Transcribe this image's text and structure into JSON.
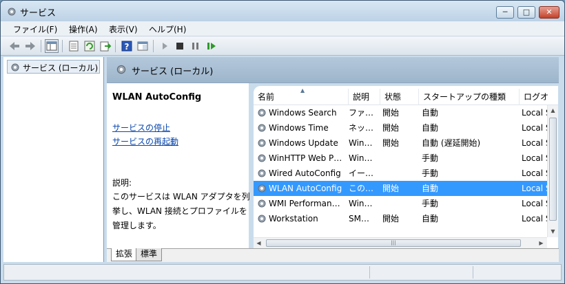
{
  "window": {
    "title": "サービス",
    "min_label": "─",
    "max_label": "□",
    "close_label": "✕"
  },
  "menu": [
    "ファイル(F)",
    "操作(A)",
    "表示(V)",
    "ヘルプ(H)"
  ],
  "toolbar": {
    "icons": [
      "back-icon",
      "forward-icon",
      "console-tree-icon",
      "properties-icon",
      "refresh-icon",
      "export-icon",
      "help-icon",
      "view-icon",
      "start-icon",
      "stop-icon",
      "pause-icon",
      "resume-icon"
    ]
  },
  "tree": {
    "item": "サービス (ローカル)"
  },
  "pane": {
    "title": "サービス (ローカル)",
    "selected_name": "WLAN AutoConfig",
    "link_stop": "サービスの停止",
    "link_restart": "サービスの再起動",
    "desc_label": "説明:",
    "desc_text": "このサービスは WLAN アダプタを列挙し、WLAN 接続とプロファイルを管理します。"
  },
  "columns": [
    "名前",
    "説明",
    "状態",
    "スタートアップの種類",
    "ログオ"
  ],
  "rows": [
    {
      "name": "Windows Search",
      "desc": "ファ…",
      "status": "開始",
      "startup": "自動",
      "logon": "Local S"
    },
    {
      "name": "Windows Time",
      "desc": "ネッ…",
      "status": "開始",
      "startup": "自動",
      "logon": "Local S"
    },
    {
      "name": "Windows Update",
      "desc": "Win…",
      "status": "開始",
      "startup": "自動 (遅延開始)",
      "logon": "Local S"
    },
    {
      "name": "WinHTTP Web P…",
      "desc": "Win…",
      "status": "",
      "startup": "手動",
      "logon": "Local S"
    },
    {
      "name": "Wired AutoConfig",
      "desc": "イー…",
      "status": "",
      "startup": "手動",
      "logon": "Local S"
    },
    {
      "name": "WLAN AutoConfig",
      "desc": "この…",
      "status": "開始",
      "startup": "自動",
      "logon": "Local S"
    },
    {
      "name": "WMI Performan…",
      "desc": "Win…",
      "status": "",
      "startup": "手動",
      "logon": "Local S"
    },
    {
      "name": "Workstation",
      "desc": "SM…",
      "status": "開始",
      "startup": "自動",
      "logon": "Local S"
    }
  ],
  "selected_row": 5,
  "tabs": [
    "拡張",
    "標準"
  ],
  "colors": {
    "selection": "#3399ff",
    "link": "#0645ad",
    "header": "#9db5cb"
  }
}
